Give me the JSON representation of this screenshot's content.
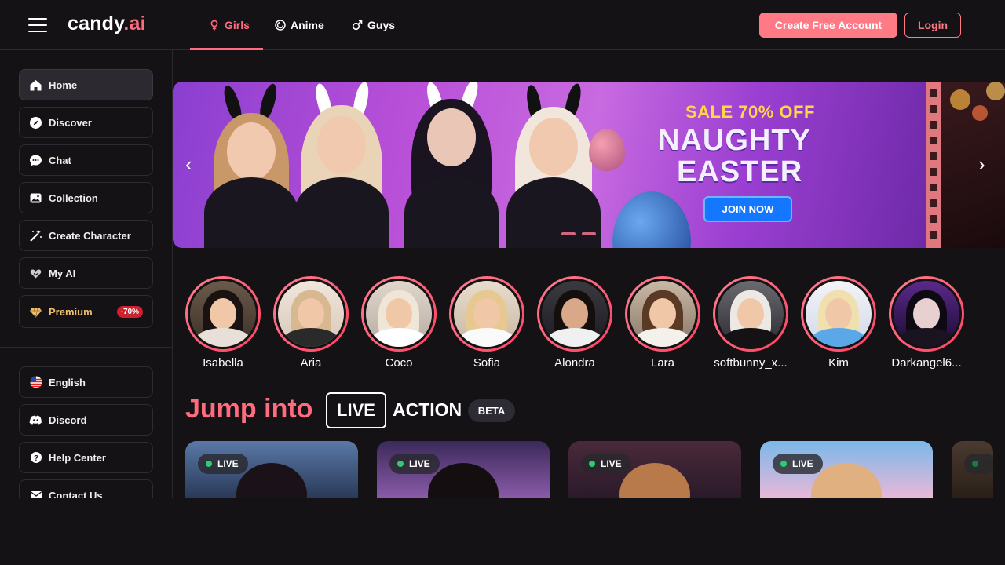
{
  "brand": {
    "name_main": "candy",
    "name_accent": ".ai"
  },
  "nav": {
    "tabs": [
      {
        "label": "Girls",
        "icon": "female-symbol-icon",
        "active": true
      },
      {
        "label": "Anime",
        "icon": "anime-swirl-icon",
        "active": false
      },
      {
        "label": "Guys",
        "icon": "male-symbol-icon",
        "active": false
      }
    ],
    "create_account": "Create Free Account",
    "login": "Login"
  },
  "sidebar": {
    "items": [
      {
        "label": "Home",
        "icon": "home-icon",
        "active": true
      },
      {
        "label": "Discover",
        "icon": "compass-icon"
      },
      {
        "label": "Chat",
        "icon": "chat-bubble-icon"
      },
      {
        "label": "Collection",
        "icon": "image-gallery-icon"
      },
      {
        "label": "Create Character",
        "icon": "magic-wand-icon"
      },
      {
        "label": "My AI",
        "icon": "heart-hands-icon"
      },
      {
        "label": "Premium",
        "icon": "diamond-icon",
        "badge": "-70%"
      }
    ],
    "secondary": [
      {
        "label": "English",
        "icon": "us-flag-icon"
      },
      {
        "label": "Discord",
        "icon": "discord-icon"
      },
      {
        "label": "Help Center",
        "icon": "help-circle-icon"
      },
      {
        "label": "Contact Us",
        "icon": "mail-icon"
      }
    ]
  },
  "banner": {
    "sale": "SALE 70% OFF",
    "line1": "NAUGHTY",
    "line2": "EASTER",
    "cta": "JOIN NOW"
  },
  "stories": [
    {
      "name": "Isabella"
    },
    {
      "name": "Aria"
    },
    {
      "name": "Coco"
    },
    {
      "name": "Sofia"
    },
    {
      "name": "Alondra"
    },
    {
      "name": "Lara"
    },
    {
      "name": "softbunny_x..."
    },
    {
      "name": "Kim"
    },
    {
      "name": "Darkangel6..."
    }
  ],
  "live_section": {
    "jump": "Jump into",
    "live": "LIVE",
    "action": "ACTION",
    "beta": "BETA",
    "card_tag": "LIVE"
  },
  "colors": {
    "accent": "#ff6b7f",
    "bg": "#141215",
    "live_dot": "#2ecc71"
  }
}
